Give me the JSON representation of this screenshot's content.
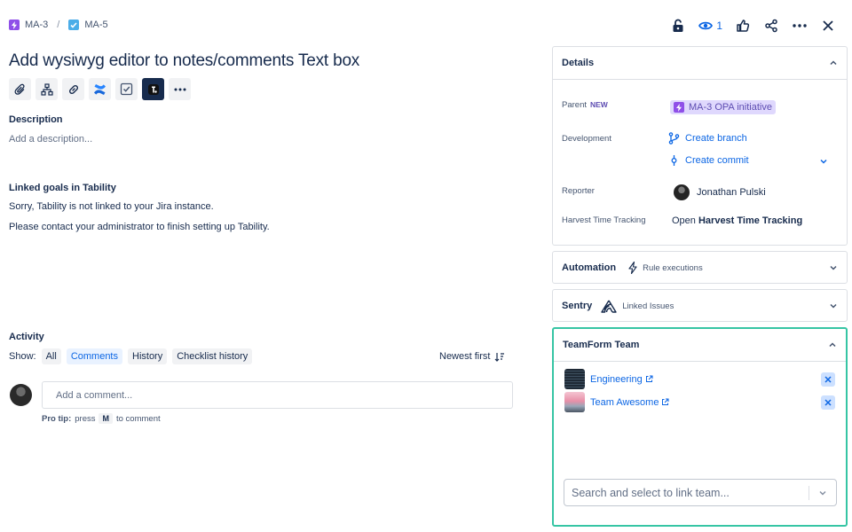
{
  "breadcrumb": {
    "parent_key": "MA-3",
    "separator": "/",
    "current_key": "MA-5"
  },
  "top_actions": {
    "watch_count": "1",
    "icons": [
      "lock-icon",
      "eye-icon",
      "thumbs-up-icon",
      "share-icon",
      "more-icon",
      "close-icon"
    ]
  },
  "issue": {
    "title": "Add wysiwyg editor to notes/comments Text box",
    "toolbar_icons": [
      "attachment-icon",
      "child-issues-icon",
      "link-icon",
      "confluence-icon",
      "checklist-icon",
      "app-icon",
      "more-icon"
    ]
  },
  "description": {
    "label": "Description",
    "placeholder": "Add a description..."
  },
  "goals": {
    "label": "Linked goals in Tability",
    "line1": "Sorry, Tability is not linked to your Jira instance.",
    "line2": "Please contact your administrator to finish setting up Tability."
  },
  "activity": {
    "label": "Activity",
    "show_label": "Show:",
    "filters": [
      "All",
      "Comments",
      "History",
      "Checklist history"
    ],
    "active_filter": "Comments",
    "sort_label": "Newest first",
    "comment_placeholder": "Add a comment...",
    "pro_tip_prefix": "Pro tip:",
    "pro_tip_press": "press",
    "pro_tip_key": "M",
    "pro_tip_suffix": "to comment"
  },
  "details": {
    "header": "Details",
    "parent_label": "Parent",
    "parent_badge": "NEW",
    "parent_value": "MA-3 OPA initiative",
    "development_label": "Development",
    "create_branch": "Create branch",
    "create_commit": "Create commit",
    "reporter_label": "Reporter",
    "reporter_name": "Jonathan Pulski",
    "harvest_label": "Harvest Time Tracking",
    "harvest_prefix": "Open",
    "harvest_value": "Harvest Time Tracking"
  },
  "automation": {
    "header": "Automation",
    "sub": "Rule executions"
  },
  "sentry": {
    "header": "Sentry",
    "sub": "Linked Issues"
  },
  "teamform": {
    "header": "TeamForm Team",
    "teams": [
      {
        "name": "Engineering"
      },
      {
        "name": "Team Awesome"
      }
    ],
    "search_placeholder": "Search and select to link team..."
  },
  "colors": {
    "accent": "#0c66e4",
    "teamform_border": "#36c5a4",
    "parent_tag_bg": "#dfd8fd"
  }
}
